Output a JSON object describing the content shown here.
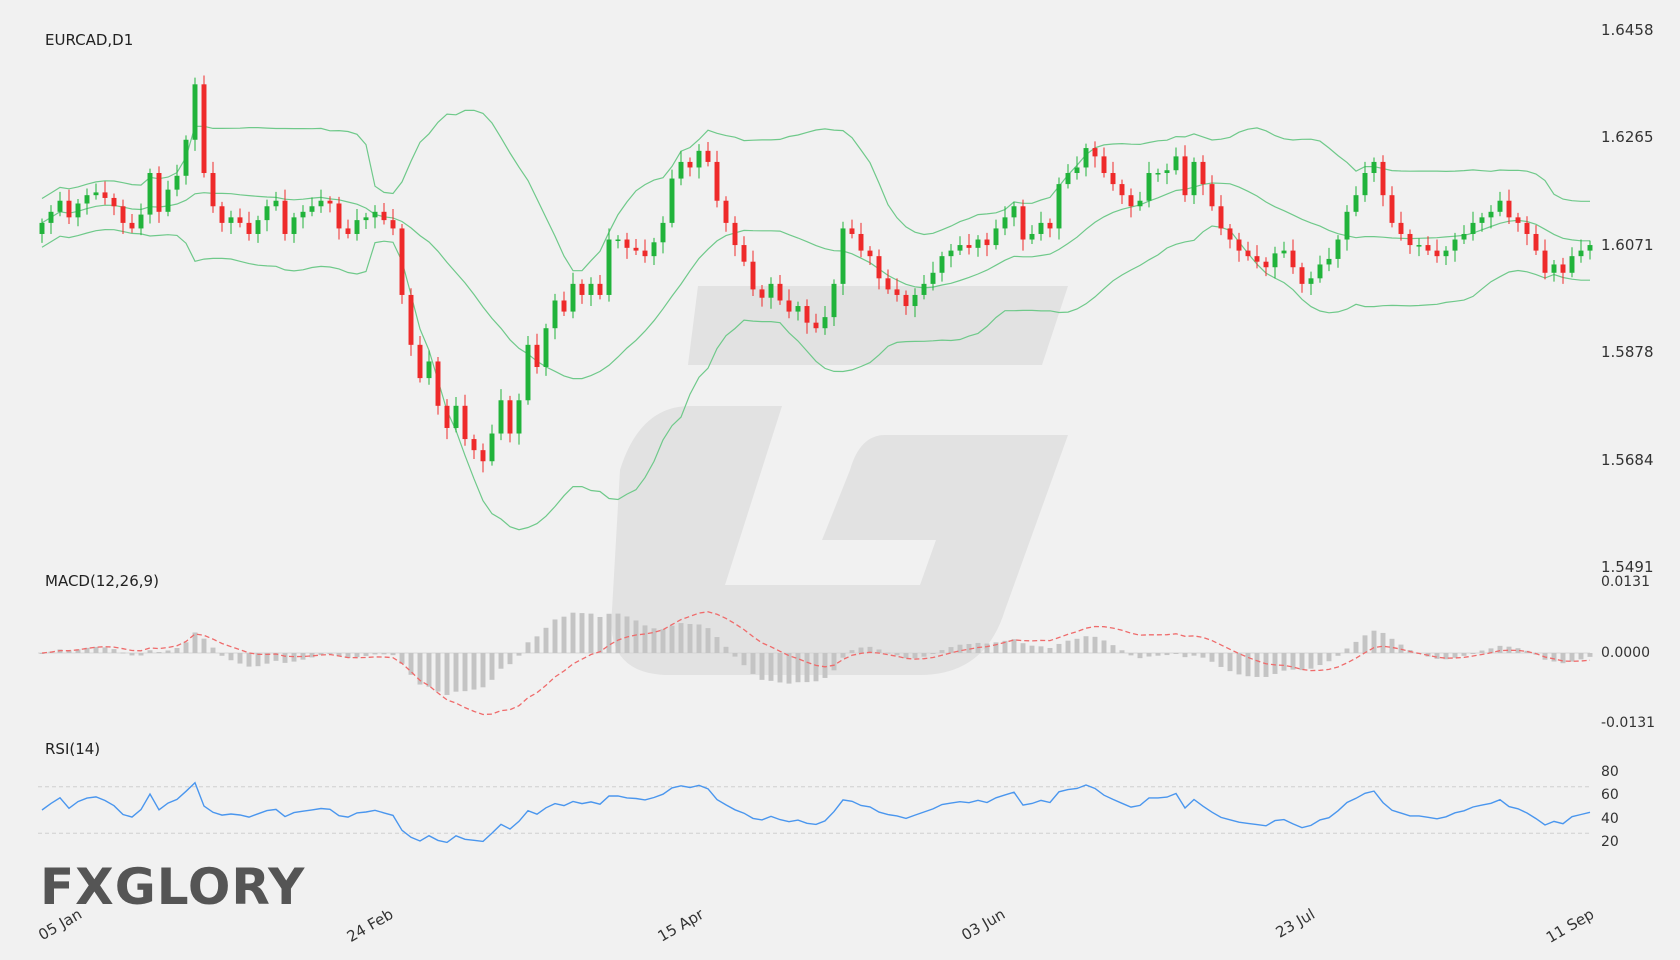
{
  "panels": {
    "price_title": "EURCAD,D1",
    "macd_title": "MACD(12,26,9)",
    "rsi_title": "RSI(14)"
  },
  "brand": {
    "name": "FXGLORY"
  },
  "colors": {
    "background": "#f1f1f1",
    "bull": "#21b33b",
    "bear": "#ee2a2a",
    "bands": "#6fc98a",
    "macd_hist": "#c4c4c4",
    "macd_signal": "#ef6b6b",
    "rsi_line": "#4a96ee",
    "watermark": "#e2e2e2"
  },
  "chart_data": [
    {
      "type": "candlestick",
      "title": "EURCAD,D1",
      "x_labels": [
        "05 Jan",
        "24 Feb",
        "15 Apr",
        "03 Jun",
        "23 Jul",
        "11 Sep"
      ],
      "y_ticks": [
        "1.6458",
        "1.6265",
        "1.6071",
        "1.5878",
        "1.5684",
        "1.5491"
      ],
      "ylim": [
        1.5491,
        1.6458
      ],
      "indicators": [
        "Bollinger Bands (20,2)"
      ],
      "closes": [
        1.611,
        1.613,
        1.615,
        1.612,
        1.6145,
        1.616,
        1.6165,
        1.6155,
        1.614,
        1.611,
        1.61,
        1.6125,
        1.62,
        1.613,
        1.617,
        1.6195,
        1.626,
        1.636,
        1.62,
        1.614,
        1.611,
        1.612,
        1.611,
        1.609,
        1.6115,
        1.614,
        1.615,
        1.609,
        1.612,
        1.613,
        1.614,
        1.615,
        1.6145,
        1.61,
        1.609,
        1.6115,
        1.612,
        1.613,
        1.6115,
        1.61,
        1.598,
        1.589,
        1.583,
        1.586,
        1.578,
        1.574,
        1.578,
        1.572,
        1.57,
        1.568,
        1.573,
        1.579,
        1.573,
        1.579,
        1.589,
        1.585,
        1.592,
        1.597,
        1.595,
        1.6,
        1.598,
        1.6,
        1.598,
        1.608,
        1.608,
        1.6065,
        1.606,
        1.605,
        1.6075,
        1.611,
        1.619,
        1.622,
        1.621,
        1.624,
        1.622,
        1.615,
        1.611,
        1.607,
        1.604,
        1.599,
        1.5975,
        1.6,
        1.597,
        1.595,
        1.596,
        1.593,
        1.592,
        1.594,
        1.6,
        1.61,
        1.609,
        1.606,
        1.605,
        1.601,
        1.599,
        1.598,
        1.596,
        1.598,
        1.6,
        1.602,
        1.605,
        1.606,
        1.607,
        1.6065,
        1.608,
        1.607,
        1.61,
        1.612,
        1.614,
        1.608,
        1.609,
        1.611,
        1.61,
        1.618,
        1.62,
        1.621,
        1.6245,
        1.623,
        1.62,
        1.618,
        1.616,
        1.614,
        1.615,
        1.62,
        1.62,
        1.6205,
        1.623,
        1.616,
        1.622,
        1.618,
        1.614,
        1.61,
        1.608,
        1.606,
        1.605,
        1.604,
        1.603,
        1.6055,
        1.606,
        1.603,
        1.6,
        1.601,
        1.6035,
        1.6045,
        1.608,
        1.613,
        1.616,
        1.62,
        1.622,
        1.616,
        1.611,
        1.609,
        1.607,
        1.607,
        1.606,
        1.605,
        1.606,
        1.608,
        1.609,
        1.611,
        1.612,
        1.613,
        1.615,
        1.612,
        1.611,
        1.609,
        1.606,
        1.602,
        1.6035,
        1.602,
        1.605,
        1.606,
        1.607
      ]
    },
    {
      "type": "line",
      "title": "MACD(12,26,9)",
      "series": [
        {
          "name": "MACD(12,26,9)"
        }
      ],
      "y_ticks": [
        "0.0131",
        "0.0000",
        "-0.0131"
      ],
      "ylim": [
        -0.0131,
        0.0131
      ]
    },
    {
      "type": "line",
      "title": "RSI(14)",
      "series": [
        {
          "name": "RSI(14)"
        }
      ],
      "y_ticks": [
        "80",
        "60",
        "40",
        "20"
      ],
      "levels": [
        30,
        70
      ]
    }
  ]
}
